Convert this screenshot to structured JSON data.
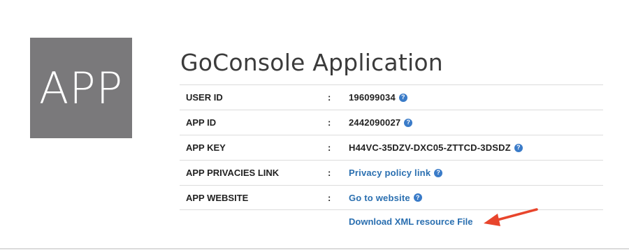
{
  "logo": {
    "text": "APP"
  },
  "title": "GoConsole Application",
  "rows": [
    {
      "label": "USER ID",
      "separator": ":",
      "value": "196099034"
    },
    {
      "label": "APP ID",
      "separator": ":",
      "value": "2442090027"
    },
    {
      "label": "APP KEY",
      "separator": ":",
      "value": "H44VC-35DZV-DXC05-ZTTCD-3DSDZ"
    },
    {
      "label": "APP PRIVACIES LINK",
      "separator": ":",
      "value": "Privacy policy link"
    },
    {
      "label": "APP WEBSITE",
      "separator": ":",
      "value": "Go to website"
    }
  ],
  "download": {
    "label": "Download XML resource File"
  },
  "help_glyph": "?",
  "colors": {
    "link": "#2a6fb0",
    "help_icon": "#3a7bc8",
    "arrow": "#e8452c",
    "logo_bg": "#7a797b"
  }
}
